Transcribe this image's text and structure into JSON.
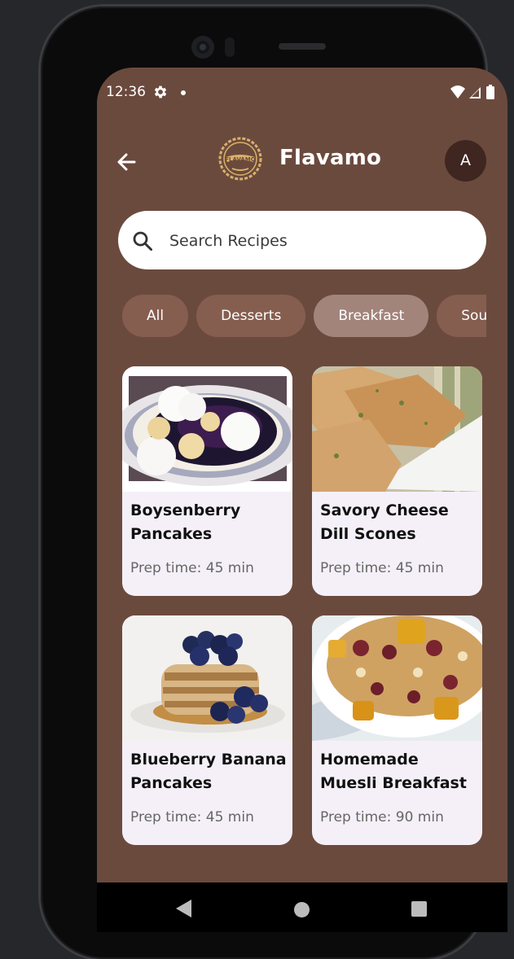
{
  "status_bar": {
    "time": "12:36",
    "icons": [
      "gear-icon",
      "notification-dot",
      "wifi-icon",
      "signal-icon",
      "battery-icon"
    ]
  },
  "header": {
    "title": "Flavamo",
    "logo_text": "FLAVAMO",
    "avatar_initial": "A"
  },
  "search": {
    "placeholder": "Search Recipes",
    "value": ""
  },
  "categories": [
    {
      "label": "All",
      "selected": false
    },
    {
      "label": "Desserts",
      "selected": false
    },
    {
      "label": "Breakfast",
      "selected": true
    },
    {
      "label": "Soups",
      "selected": false
    }
  ],
  "recipes": [
    {
      "title": "Boysenberry Pancakes",
      "prep": "Prep time: 45 min",
      "image": "boysenberry pancakes with whipped cream and banana"
    },
    {
      "title": "Savory Cheese Dill Scones",
      "prep": "Prep time: 45 min",
      "image": "cheese dill scones on white plate"
    },
    {
      "title": "Blueberry Banana Pancakes",
      "prep": "Prep time: 45 min",
      "image": "pancake stack topped with blueberries and syrup"
    },
    {
      "title": "Homemade Muesli Breakfast",
      "prep": "Prep time: 90 min",
      "image": "bowl of muesli with dried fruit"
    }
  ],
  "colors": {
    "screen_bg": "#6b4a3e",
    "chip": "#855e4f",
    "chip_selected": "#a2847b",
    "card_bg": "#f5f0f8",
    "avatar_bg": "#3f2620"
  },
  "nav_bar": [
    "nav-back-icon",
    "nav-home-icon",
    "nav-recents-icon"
  ]
}
